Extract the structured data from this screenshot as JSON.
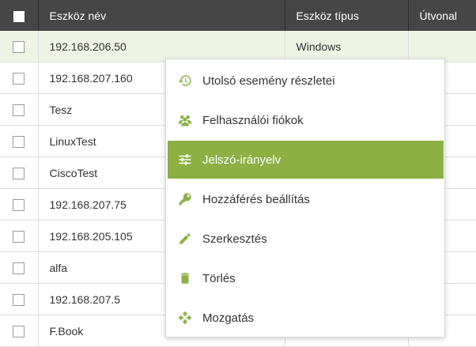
{
  "table": {
    "headers": {
      "name": "Eszköz név",
      "type": "Eszköz típus",
      "path": "Útvonal"
    },
    "rows": [
      {
        "name": "192.168.206.50",
        "type": "Windows"
      },
      {
        "name": "192.168.207.160",
        "type": ""
      },
      {
        "name": "Tesz",
        "type": ""
      },
      {
        "name": "LinuxTest",
        "type": ""
      },
      {
        "name": "CiscoTest",
        "type": ""
      },
      {
        "name": "192.168.207.75",
        "type": ""
      },
      {
        "name": "192.168.205.105",
        "type": ""
      },
      {
        "name": "alfa",
        "type": ""
      },
      {
        "name": "192.168.207.5",
        "type": ""
      },
      {
        "name": "F.Book",
        "type": ""
      }
    ]
  },
  "context_menu": {
    "items": [
      {
        "label": "Utolsó esemény részletei",
        "icon": "history-icon"
      },
      {
        "label": "Felhasználói fiókok",
        "icon": "users-icon"
      },
      {
        "label": "Jelszó-irányelv",
        "icon": "sliders-icon"
      },
      {
        "label": "Hozzáférés beállítás",
        "icon": "key-icon"
      },
      {
        "label": "Szerkesztés",
        "icon": "pencil-icon"
      },
      {
        "label": "Törlés",
        "icon": "trash-icon"
      },
      {
        "label": "Mozgatás",
        "icon": "move-icon"
      }
    ],
    "active_item": "Jelszó-irányelv"
  },
  "colors": {
    "header_bg": "#464646",
    "accent": "#8cb043",
    "selected_row_bg": "#eef3e3"
  }
}
